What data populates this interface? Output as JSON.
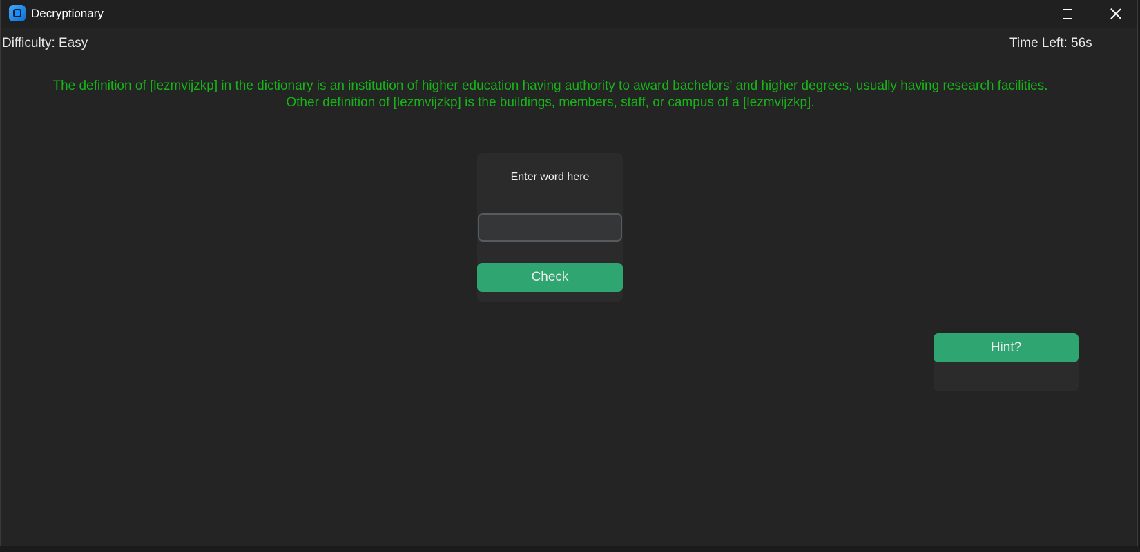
{
  "window": {
    "title": "Decryptionary"
  },
  "status": {
    "difficulty": "Difficulty: Easy",
    "time_left": "Time Left: 56s"
  },
  "definition": {
    "line1": "The definition of [lezmvijzkp] in the dictionary is an institution of higher education having authority to award bachelors' and higher degrees, usually having research facilities.",
    "line2": "Other definition of [lezmvijzkp] is the buildings, members, staff, or campus of a [lezmvijzkp]."
  },
  "entry": {
    "label": "Enter word here",
    "value": "",
    "placeholder": "",
    "check_label": "Check"
  },
  "hint": {
    "button_label": "Hint?",
    "text": ""
  },
  "colors": {
    "background": "#242424",
    "card": "#2b2b2b",
    "accent_green": "#2fa572",
    "definition_text": "#17b317"
  },
  "icons": {
    "app": "app-logo-icon",
    "minimize": "minimize-icon",
    "maximize": "maximize-icon",
    "close": "close-icon"
  }
}
